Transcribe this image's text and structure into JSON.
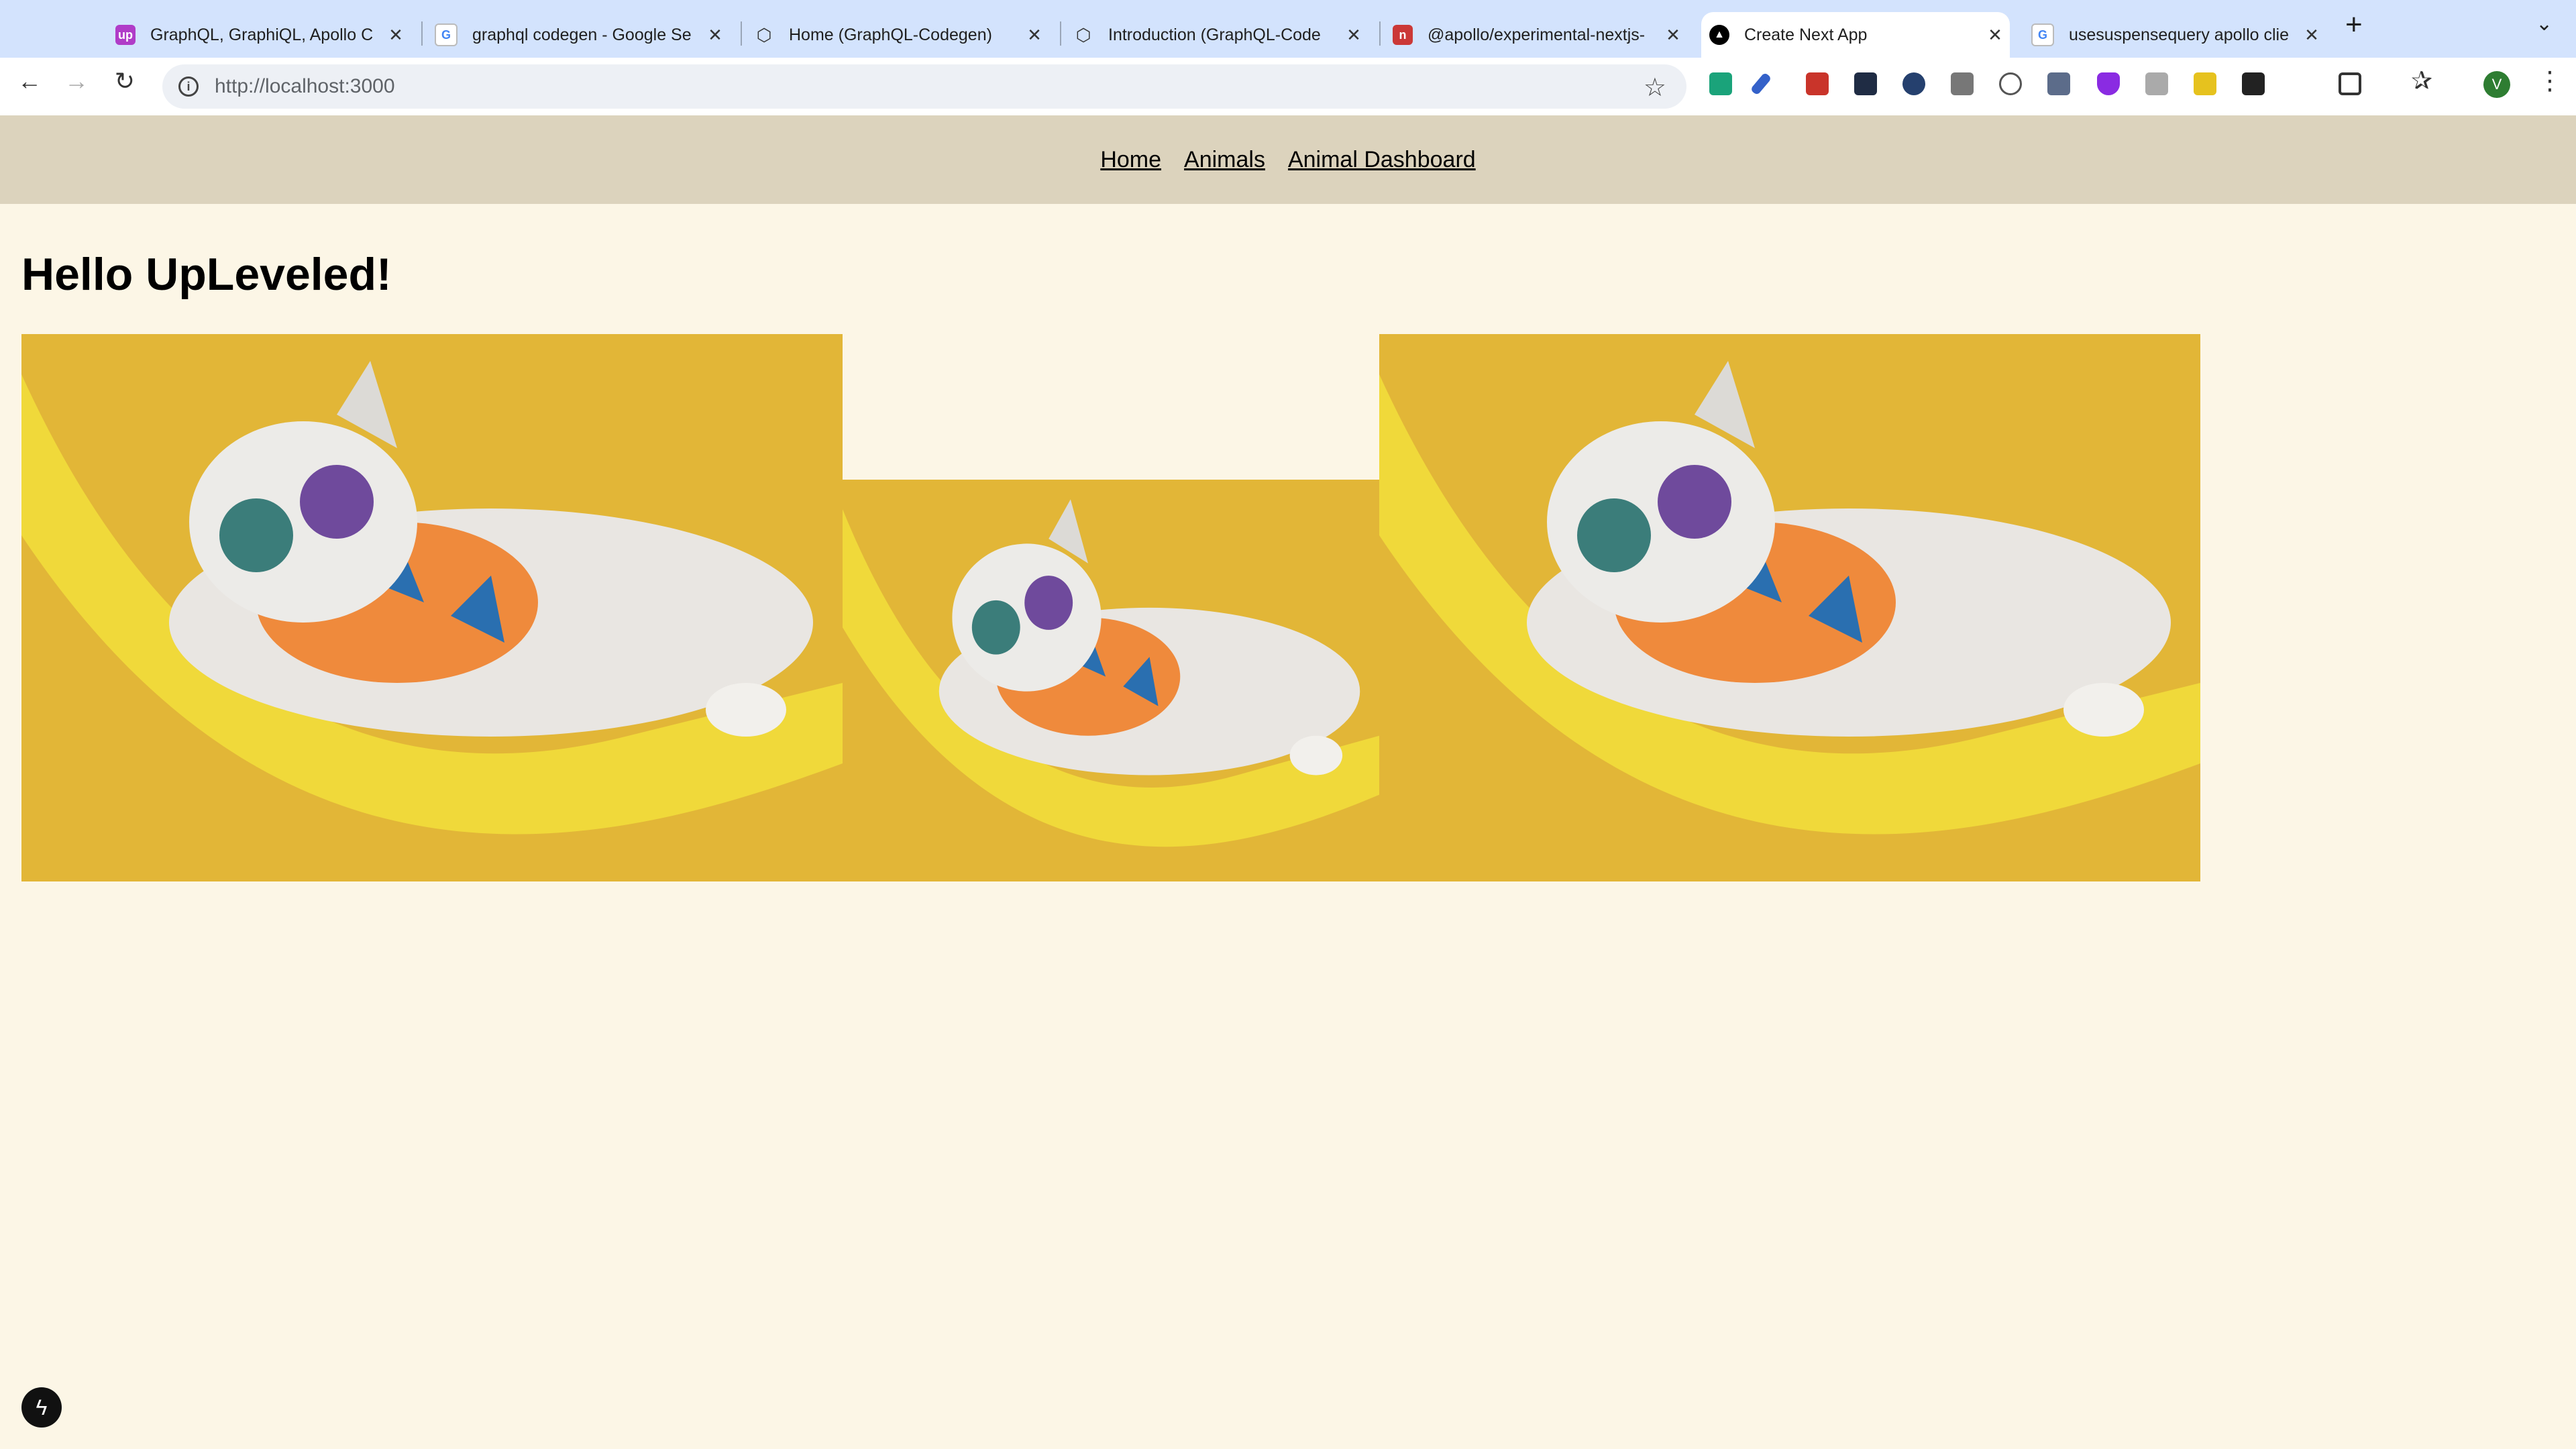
{
  "browser": {
    "tabs": [
      {
        "title": "GraphQL, GraphiQL, Apollo C",
        "icon": "upleveled-favicon"
      },
      {
        "title": "graphql codegen - Google Se",
        "icon": "google-favicon"
      },
      {
        "title": "Home (GraphQL-Codegen)",
        "icon": "graphql-codegen-favicon"
      },
      {
        "title": "Introduction (GraphQL-Code",
        "icon": "graphql-codegen-favicon"
      },
      {
        "title": "@apollo/experimental-nextjs-",
        "icon": "npm-favicon"
      },
      {
        "title": "Create Next App",
        "icon": "nextjs-favicon",
        "active": true
      },
      {
        "title": "usesuspensequery apollo clie",
        "icon": "google-favicon"
      }
    ],
    "address": "http://localhost:3000",
    "profile_initial": "V"
  },
  "nav": {
    "links": [
      "Home",
      "Animals",
      "Animal Dashboard"
    ]
  },
  "page": {
    "heading": "Hello UpLeveled!",
    "images": [
      "cat-in-hammock-photo",
      "cat-in-hammock-photo",
      "cat-in-hammock-photo"
    ]
  },
  "colors": {
    "page_bg": "#fcf6e6",
    "header_bg": "#dcd3bd",
    "tabstrip_bg": "#d3e3fd",
    "photo_bg": "#e2b637"
  }
}
